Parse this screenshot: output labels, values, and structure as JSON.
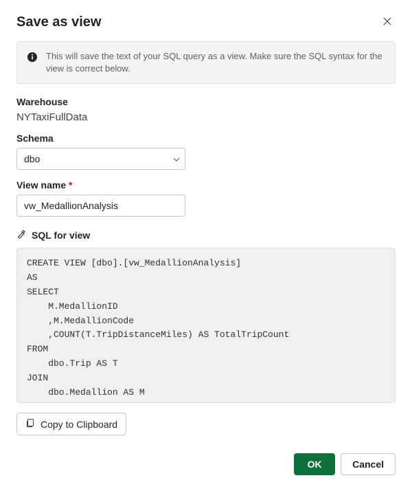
{
  "dialog": {
    "title": "Save as view",
    "info_text": "This will save the text of your SQL query as a view. Make sure the SQL syntax for the view is correct below."
  },
  "warehouse": {
    "label": "Warehouse",
    "value": "NYTaxiFullData"
  },
  "schema": {
    "label": "Schema",
    "value": "dbo"
  },
  "view_name": {
    "label": "View name",
    "required_marker": "*",
    "value": "vw_MedallionAnalysis"
  },
  "sql_section": {
    "label": "SQL for view",
    "code": "CREATE VIEW [dbo].[vw_MedallionAnalysis]\nAS\nSELECT\n    M.MedallionID\n    ,M.MedallionCode\n    ,COUNT(T.TripDistanceMiles) AS TotalTripCount\nFROM\n    dbo.Trip AS T\nJOIN\n    dbo.Medallion AS M"
  },
  "buttons": {
    "copy": "Copy to Clipboard",
    "ok": "OK",
    "cancel": "Cancel"
  }
}
